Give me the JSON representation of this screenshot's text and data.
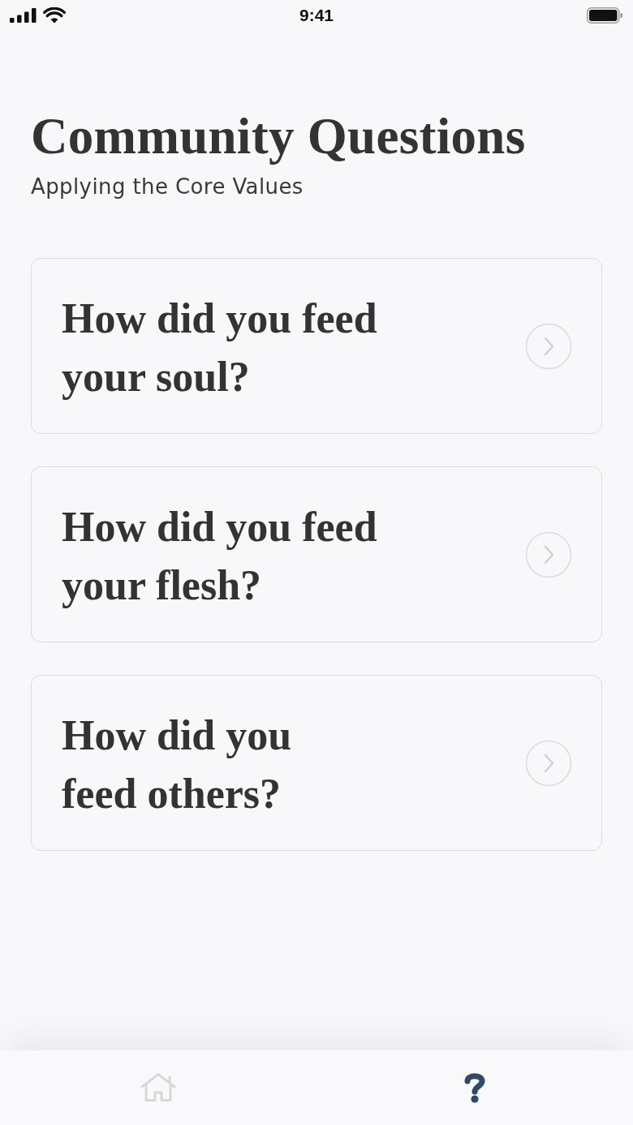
{
  "status_bar": {
    "time": "9:41"
  },
  "header": {
    "title": "Community Questions",
    "subtitle": "Applying the Core Values"
  },
  "questions": [
    {
      "text": "How did you feed\nyour soul?"
    },
    {
      "text": "How did you feed\nyour flesh?"
    },
    {
      "text": "How did you\nfeed others?"
    }
  ],
  "tab_bar": {
    "tabs": [
      {
        "kind": "home",
        "selected": false
      },
      {
        "kind": "help",
        "selected": true
      }
    ]
  }
}
